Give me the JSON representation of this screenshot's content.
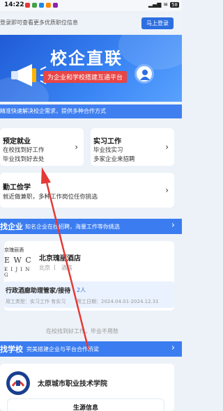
{
  "status_bar": {
    "time": "14:22",
    "right": "◉ 📶 ⟳ ✦ ▮▮ ⌔",
    "battery": "58"
  },
  "login_bar": {
    "text": "登录即可查看更多优质职位信息",
    "button": "马上登录"
  },
  "banner": {
    "title": "校企直联",
    "subtitle": "为企业和学校搭建互通平台"
  },
  "strip": {
    "text": "精准快速解决校企需求，提供多种合作方式"
  },
  "cards": [
    {
      "title": "预定就业",
      "lines": [
        "在校找到好工作",
        "毕业找到好去处"
      ]
    },
    {
      "title": "实习工作",
      "lines": [
        "毕业找实习",
        "多家企业来招聘"
      ]
    },
    {
      "title": "勤工俭学",
      "lines": [
        "就近做兼职，多种工作岗位任你挑选"
      ]
    }
  ],
  "find_company": {
    "title": "找企业",
    "desc": "知名企业在线招聘，海量工作等你挑选",
    "chevron": "›"
  },
  "company": {
    "logo_lines": [
      "京瑰丽酒",
      "E W C",
      "E I J I N G"
    ],
    "name": "北京瑰丽酒店",
    "city": "北京",
    "sep": "|",
    "industry": "酒店",
    "job_title": "行政酒廊助理管家/接待",
    "job_count": "2人",
    "job_type_label": "用工类型：实习工作 有实习",
    "job_date_label": "用工日期：2024.04.01-2024.12.31"
  },
  "footer_hint": "在校找到好工作，毕业不用愁",
  "find_school": {
    "title": "找学校",
    "desc": "完美搭建企业与平台合作桥梁",
    "chevron": "›"
  },
  "school": {
    "name": "太原城市职业技术学院",
    "sub": "生源信息"
  },
  "colors": {
    "primary": "#3b7cf0",
    "accent": "#e84545"
  }
}
